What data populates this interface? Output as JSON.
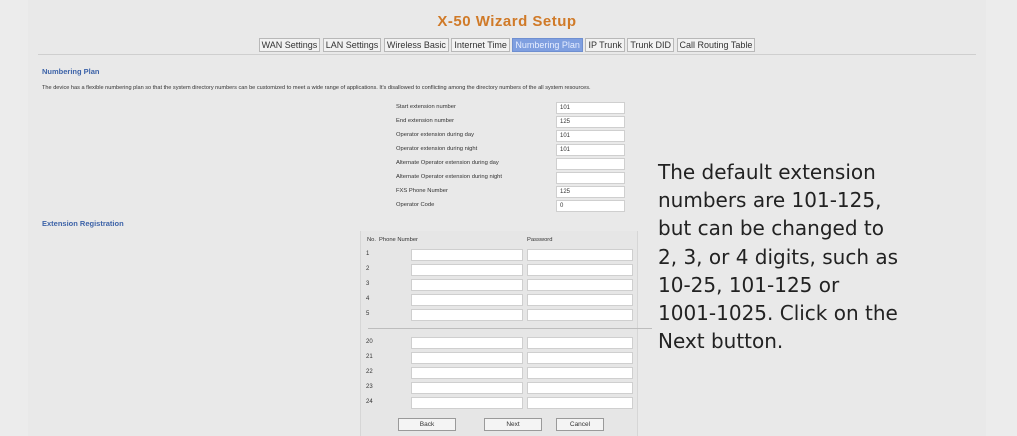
{
  "title": "X-50 Wizard Setup",
  "tabs": [
    {
      "label": "WAN Settings",
      "active": false
    },
    {
      "label": "LAN Settings",
      "active": false
    },
    {
      "label": "Wireless Basic",
      "active": false
    },
    {
      "label": "Internet Time",
      "active": false
    },
    {
      "label": "Numbering Plan",
      "active": true
    },
    {
      "label": "IP Trunk",
      "active": false
    },
    {
      "label": "Trunk DID",
      "active": false
    },
    {
      "label": "Call Routing Table",
      "active": false
    }
  ],
  "numbering_plan": {
    "heading": "Numbering Plan",
    "description": "The device has a flexible numbering plan so that the system directory numbers can be customized to meet a wide range of applications. It's disallowed to conflicting among the directory numbers of the all system resources.",
    "fields": [
      {
        "label": "Start extension number",
        "value": "101"
      },
      {
        "label": "End extension number",
        "value": "125"
      },
      {
        "label": "Operator extension during day",
        "value": "101"
      },
      {
        "label": "Operator extension during night",
        "value": "101"
      },
      {
        "label": "Alternate Operator extension during day",
        "value": ""
      },
      {
        "label": "Alternate Operator extension during night",
        "value": ""
      },
      {
        "label": "FXS Phone Number",
        "value": "125"
      },
      {
        "label": "Operator Code",
        "value": "0"
      }
    ]
  },
  "extension_registration": {
    "heading": "Extension Registration",
    "columns": {
      "no": "No.",
      "phone": "Phone Number",
      "password": "Password"
    },
    "rows_top": [
      "1",
      "2",
      "3",
      "4",
      "5"
    ],
    "rows_bottom": [
      "20",
      "21",
      "22",
      "23",
      "24"
    ]
  },
  "buttons": {
    "back": "Back",
    "next": "Next",
    "cancel": "Cancel"
  },
  "callout_lines": [
    "The default extension",
    "numbers are 101-125,",
    "but can be changed to",
    "2, 3, or 4 digits, such as",
    "10-25, 101-125 or",
    "1001-1025. Click on the",
    "Next button."
  ]
}
